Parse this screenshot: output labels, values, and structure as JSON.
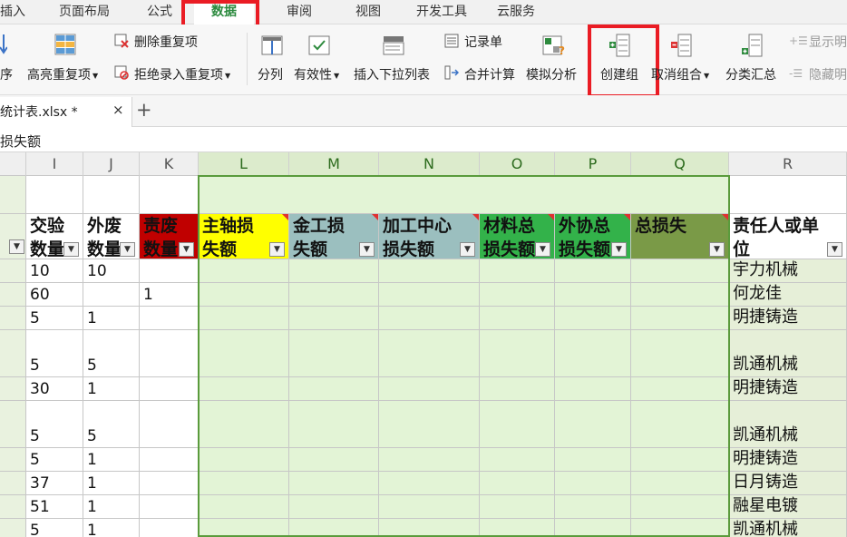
{
  "menu": {
    "items": [
      "插入",
      "页面布局",
      "公式",
      "数据",
      "审阅",
      "视图",
      "开发工具",
      "云服务"
    ],
    "active_index": 3
  },
  "ribbon": {
    "sort_label": "序",
    "highlight_dup": "高亮重复项",
    "delete_dup": "删除重复项",
    "reject_dup": "拒绝录入重复项",
    "split": "分列",
    "validity": "有效性",
    "insert_dropdown": "插入下拉列表",
    "record_form": "记录单",
    "merge_calc": "合并计算",
    "simulate": "模拟分析",
    "create_group": "创建组",
    "ungroup": "取消组合",
    "subtotal": "分类汇总",
    "show_detail": "显示明",
    "hide_detail": "隐藏明"
  },
  "tabs": {
    "doc_name": "统计表.xlsx *",
    "close": "×",
    "add": "+"
  },
  "formula_bar": {
    "content": "损失额"
  },
  "columns": [
    "I",
    "J",
    "K",
    "L",
    "M",
    "N",
    "O",
    "P",
    "Q",
    "R"
  ],
  "headers": [
    "交验\n数量",
    "外废\n数量",
    "责废\n数量",
    "主轴损\n失额",
    "金工损\n失额",
    "加工中心\n损失额",
    "材料总\n损失额",
    "外协总\n损失额",
    "总损失",
    "责任人或单\n位"
  ],
  "header_colors": [
    "#ffffff",
    "#ffffff",
    "#c00000",
    "#ffff00",
    "#9bbfbf",
    "#9bbfbf",
    "#33b24a",
    "#33b24a",
    "#7a9a47",
    "#ffffff"
  ],
  "rows": [
    {
      "I": "10",
      "J": "10",
      "K": "",
      "R": "宇力机械"
    },
    {
      "I": "60",
      "J": "",
      "K": "1",
      "R": "何龙佳"
    },
    {
      "I": "5",
      "J": "1",
      "K": "",
      "R": "明捷铸造"
    },
    {
      "I": "5",
      "J": "5",
      "K": "",
      "R": "凯通机械"
    },
    {
      "I": "30",
      "J": "1",
      "K": "",
      "R": "明捷铸造"
    },
    {
      "I": "5",
      "J": "5",
      "K": "",
      "R": "凯通机械"
    },
    {
      "I": "5",
      "J": "1",
      "K": "",
      "R": "明捷铸造"
    },
    {
      "I": "37",
      "J": "1",
      "K": "",
      "R": "日月铸造"
    },
    {
      "I": "51",
      "J": "1",
      "K": "",
      "R": "融星电镀"
    },
    {
      "I": "5",
      "J": "1",
      "K": "",
      "R": "凯通机械"
    }
  ],
  "colors": {
    "active_menu": "#2b8a3e",
    "highlight_box": "#ea1c24",
    "selection_fill": "#e3f4d6",
    "selection_border": "#5a9b3c"
  }
}
